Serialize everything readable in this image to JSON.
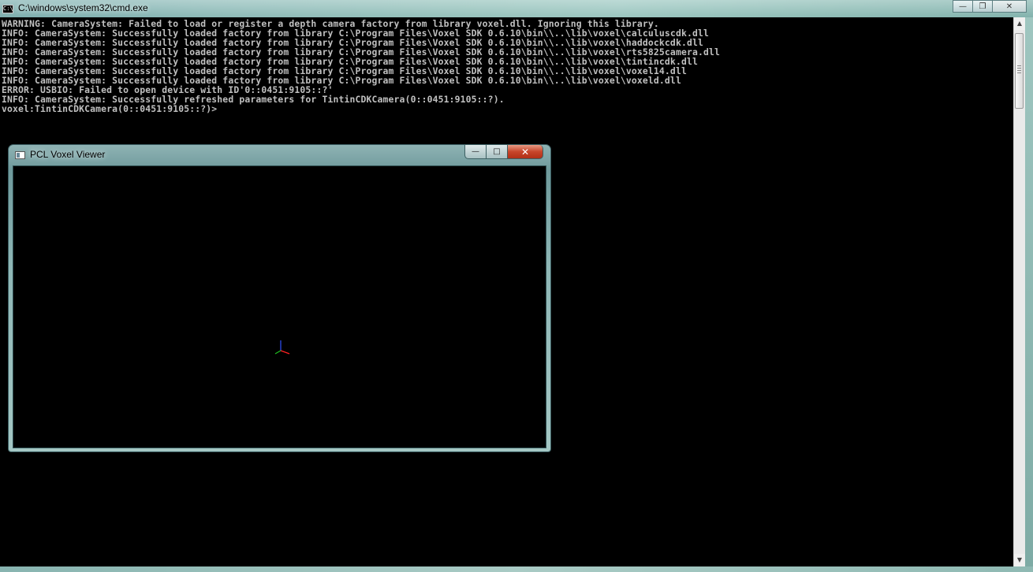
{
  "cmd": {
    "title": "C:\\windows\\system32\\cmd.exe",
    "icon": "cmd-icon",
    "icon_glyph": "C:\\",
    "controls": {
      "minimize": "—",
      "maximize": "❐",
      "close": "✕"
    },
    "lines": [
      "WARNING: CameraSystem: Failed to load or register a depth camera factory from library voxel.dll. Ignoring this library.",
      "INFO: CameraSystem: Successfully loaded factory from library C:\\Program Files\\Voxel SDK 0.6.10\\bin\\\\..\\lib\\voxel\\calculuscdk.dll",
      "INFO: CameraSystem: Successfully loaded factory from library C:\\Program Files\\Voxel SDK 0.6.10\\bin\\\\..\\lib\\voxel\\haddockcdk.dll",
      "INFO: CameraSystem: Successfully loaded factory from library C:\\Program Files\\Voxel SDK 0.6.10\\bin\\\\..\\lib\\voxel\\rts5825camera.dll",
      "INFO: CameraSystem: Successfully loaded factory from library C:\\Program Files\\Voxel SDK 0.6.10\\bin\\\\..\\lib\\voxel\\tintincdk.dll",
      "INFO: CameraSystem: Successfully loaded factory from library C:\\Program Files\\Voxel SDK 0.6.10\\bin\\\\..\\lib\\voxel\\voxel14.dll",
      "INFO: CameraSystem: Successfully loaded factory from library C:\\Program Files\\Voxel SDK 0.6.10\\bin\\\\..\\lib\\voxel\\voxeld.dll",
      "ERROR: USBIO: Failed to open device with ID'0::0451:9105::?'",
      "INFO: CameraSystem: Successfully refreshed parameters for TintinCDKCamera(0::0451:9105::?).",
      "voxel:TintinCDKCamera(0::0451:9105::?)>"
    ]
  },
  "pcl": {
    "title": "PCL Voxel Viewer",
    "controls": {
      "minimize": "—",
      "maximize": "□",
      "close": "✕"
    },
    "axis_colors": {
      "x": "#ff2020",
      "y": "#20c020",
      "z": "#3050ff"
    }
  },
  "scrollbar": {
    "up": "▲",
    "down": "▼"
  }
}
